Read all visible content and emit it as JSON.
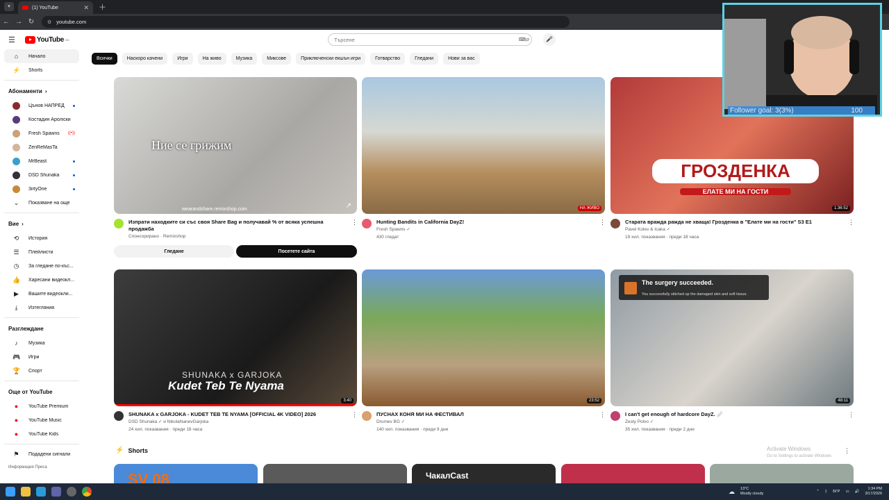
{
  "browser": {
    "tab_title": "(1) YouTube",
    "url": "youtube.com"
  },
  "header": {
    "logo_text": "YouTube",
    "logo_sup": "BG",
    "search_placeholder": "Търсене"
  },
  "chips": [
    "Всички",
    "Наскоро качени",
    "Игри",
    "На живо",
    "Музика",
    "Миксове",
    "Приключенски екшън игри",
    "Готварство",
    "Гледани",
    "Нови за вас"
  ],
  "sidebar": {
    "main": [
      {
        "label": "Начало",
        "icon": "home-icon",
        "glyph": "⌂"
      },
      {
        "label": "Shorts",
        "icon": "shorts-icon",
        "glyph": "⚡"
      }
    ],
    "subs_title": "Абонаменти",
    "subs": [
      {
        "label": "Цънов НАПРЕД ...",
        "color": "#8a2b2b",
        "mark": "dot"
      },
      {
        "label": "Костадин Ароліски",
        "color": "#5a3a7a",
        "mark": ""
      },
      {
        "label": "Fresh Spawns",
        "color": "#c9a27a",
        "mark": "live"
      },
      {
        "label": "ZenReMasTa",
        "color": "#d4b49a",
        "mark": ""
      },
      {
        "label": "MrBeast",
        "color": "#3aa0c8",
        "mark": "dot"
      },
      {
        "label": "DSD Shunaka",
        "color": "#333333",
        "mark": "dot"
      },
      {
        "label": "3irtyOne",
        "color": "#c88a3a",
        "mark": "dot"
      }
    ],
    "show_more": "Показване на още",
    "you_title": "Вие",
    "you": [
      {
        "label": "История",
        "icon": "history-icon",
        "glyph": "⟲"
      },
      {
        "label": "Плейлисти",
        "icon": "playlist-icon",
        "glyph": "☰"
      },
      {
        "label": "За гледане по-къс...",
        "icon": "clock-icon",
        "glyph": "◷"
      },
      {
        "label": "Харесани видеокл...",
        "icon": "like-icon",
        "glyph": "👍"
      },
      {
        "label": "Вашите видеокли...",
        "icon": "video-icon",
        "glyph": "▶"
      },
      {
        "label": "Изтегляния",
        "icon": "download-icon",
        "glyph": "⤓"
      }
    ],
    "explore_title": "Разглеждане",
    "explore": [
      {
        "label": "Музика",
        "icon": "music-icon",
        "glyph": "♪"
      },
      {
        "label": "Игри",
        "icon": "gaming-icon",
        "glyph": "🎮"
      },
      {
        "label": "Спорт",
        "icon": "sport-icon",
        "glyph": "🏆"
      }
    ],
    "more_title": "Още от YouTube",
    "more": [
      {
        "label": "YouTube Premium"
      },
      {
        "label": "YouTube Music"
      },
      {
        "label": "YouTube Kids"
      }
    ],
    "report": "Подадени сигнали",
    "footer": "Информация  Преса"
  },
  "videos": [
    {
      "title": "Изпрати находките си със своя Share Bag и получавай % от всяка успешна продажба",
      "channel": "Спонсорирано · Remixshop",
      "stats": "",
      "duration": "",
      "overlay_text": "Ние се грижим",
      "overlay_small": "wearandshare.remixshop.com",
      "btn1": "Гледане",
      "btn2": "Посетете сайта",
      "bg": "linear-gradient(135deg,#d9d9d6,#a9a8a4 60%,#c6c1bd)",
      "av": "#a6e22e"
    },
    {
      "title": "Hunting Bandits in California DayZ!",
      "channel": "Fresh Spawns ✓",
      "stats": "430 гледат",
      "duration": "НА ЖИВО",
      "live": true,
      "bg": "linear-gradient(180deg,#a9c8e0 0%,#d6d8d2 40%,#b58e5e 70%,#8a6a45 100%)",
      "av": "#e85a70"
    },
    {
      "title": "Старата вражда ражда не хваща! Грозденка в \"Елате ми на гости\" S3 E1",
      "channel": "Pavel Kolev & Icaka ✓",
      "stats": "19 хил. показвания · преди 18 часа",
      "duration": "1:36:52",
      "overlay_text": "ГРОЗДЕНКА",
      "overlay_small": "ЕЛАТЕ МИ НА ГОСТИ",
      "bg": "linear-gradient(135deg,#b23a3a,#e2735a 50%,#7a2020)",
      "av": "#7a4a3a"
    },
    {
      "title": "SHUNAKA x GARJOKA - KUDET TEB TE NYAMA [OFFICIAL 4K VIDEO] 2026",
      "channel": "DSD Shunaka ✓ и NikolaNanevGarjoka",
      "stats": "24 хил. показвания · преди 18 часа",
      "duration": "3:40",
      "overlay_text": "Kudet Teb Te Nyama",
      "overlay_small": "SHUNAKA x GARJOKA",
      "bg": "linear-gradient(135deg,#3d3d3d,#1a1a1a 60%,#5a4a3a)",
      "av": "#333333"
    },
    {
      "title": "ПУСНАХ КОНЯ МИ НА ФЕСТИВАЛ",
      "channel": "Drumev BG ✓",
      "stats": "140 хил. показвания · преди 9 дни",
      "duration": "23:52",
      "bg": "linear-gradient(180deg,#6a9ad8 0%,#7aa85a 35%,#b8a080 70%,#8a5a30 100%)",
      "av": "#d9a070"
    },
    {
      "title": "I can't get enough of hardcore DayZ. 🩹",
      "channel": "Zesty Polvo ✓",
      "stats": "35 хил. показвания · преди 2 дни",
      "duration": "48:11",
      "overlay_text": "The surgery succeeded.",
      "overlay_small": "You successfully stitched up the damaged skin and soft tissue.",
      "bg": "linear-gradient(135deg,#8f9aa3,#d9d4cc 55%,#6f7a80)",
      "av": "#c04070"
    }
  ],
  "shorts_title": "Shorts",
  "shorts": [
    {
      "label": "SV 08",
      "bg": "#4a8ad8"
    },
    {
      "label": "",
      "bg": "#5a5a5a"
    },
    {
      "label": "ЧакалCast",
      "bg": "#2a2a2a"
    },
    {
      "label": "",
      "bg": "#c0304a"
    },
    {
      "label": "",
      "bg": "#9aa8a0"
    }
  ],
  "stream_overlay": {
    "goal_label": "Follower goal:",
    "goal_value": "3(3%)",
    "goal_max": "100"
  },
  "watermark": {
    "title": "Activate Windows",
    "sub": "Go to Settings to activate Windows"
  },
  "taskbar": {
    "weather_temp": "13°C",
    "weather_desc": "Mostly cloudy",
    "lang": "БГР",
    "time": "1:34 PM",
    "date": "3/17/2026"
  }
}
